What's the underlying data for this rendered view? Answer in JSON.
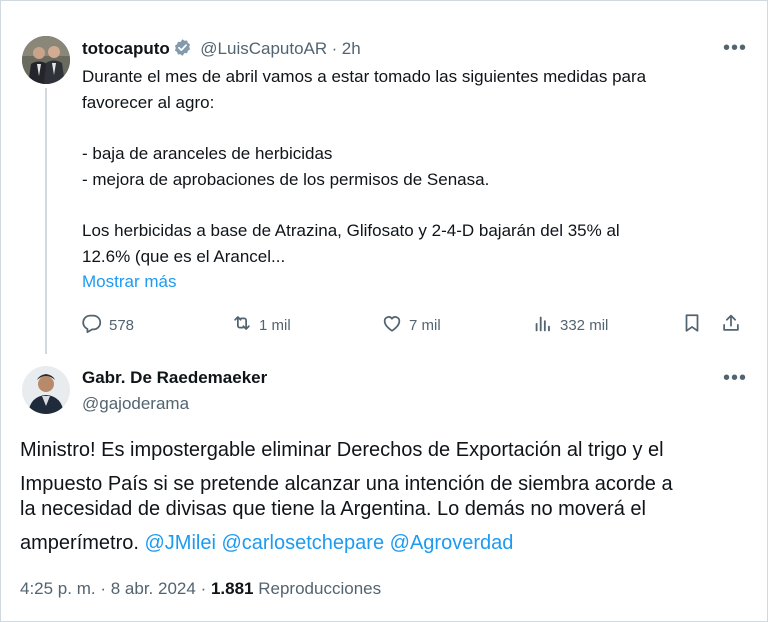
{
  "tweet": {
    "display_name": "totocaputo",
    "handle": "@LuisCaputoAR",
    "separator": "·",
    "time": "2h",
    "lines": [
      "Durante el mes de abril vamos a estar tomado las siguientes medidas para",
      "favorecer al agro:",
      "- baja de aranceles de herbicidas",
      "- mejora de aprobaciones de los permisos de Senasa.",
      "Los herbicidas a base de Atrazina, Glifosato y 2-4-D  bajarán del 35% al",
      "12.6% (que es el Arancel..."
    ],
    "show_more": "Mostrar más",
    "actions": {
      "replies": "578",
      "reposts": "1 mil",
      "likes": "7 mil",
      "views": "332 mil"
    }
  },
  "reply": {
    "display_name": "Gabr. De Raedemaeker",
    "handle": "@gajoderama",
    "lines": [
      "Ministro! Es impostergable eliminar Derechos de Exportación al trigo y el",
      "Impuesto País si se pretende alcanzar una intención de siembra acorde a",
      "la necesidad de divisas que tiene la Argentina. Lo demás no moverá el",
      "amperímetro. "
    ],
    "mentions": [
      "@JMilei",
      "@carlosetchepare",
      "@Agroverdad"
    ],
    "time": "4:25 p. m.",
    "date": "8 abr. 2024",
    "separator": "·",
    "views_count": "1.881",
    "views_label": "Reproducciones"
  },
  "colors": {
    "accent": "#1d9bf0",
    "muted": "#536471",
    "text": "#0f1419",
    "divider": "#cfd9de"
  }
}
